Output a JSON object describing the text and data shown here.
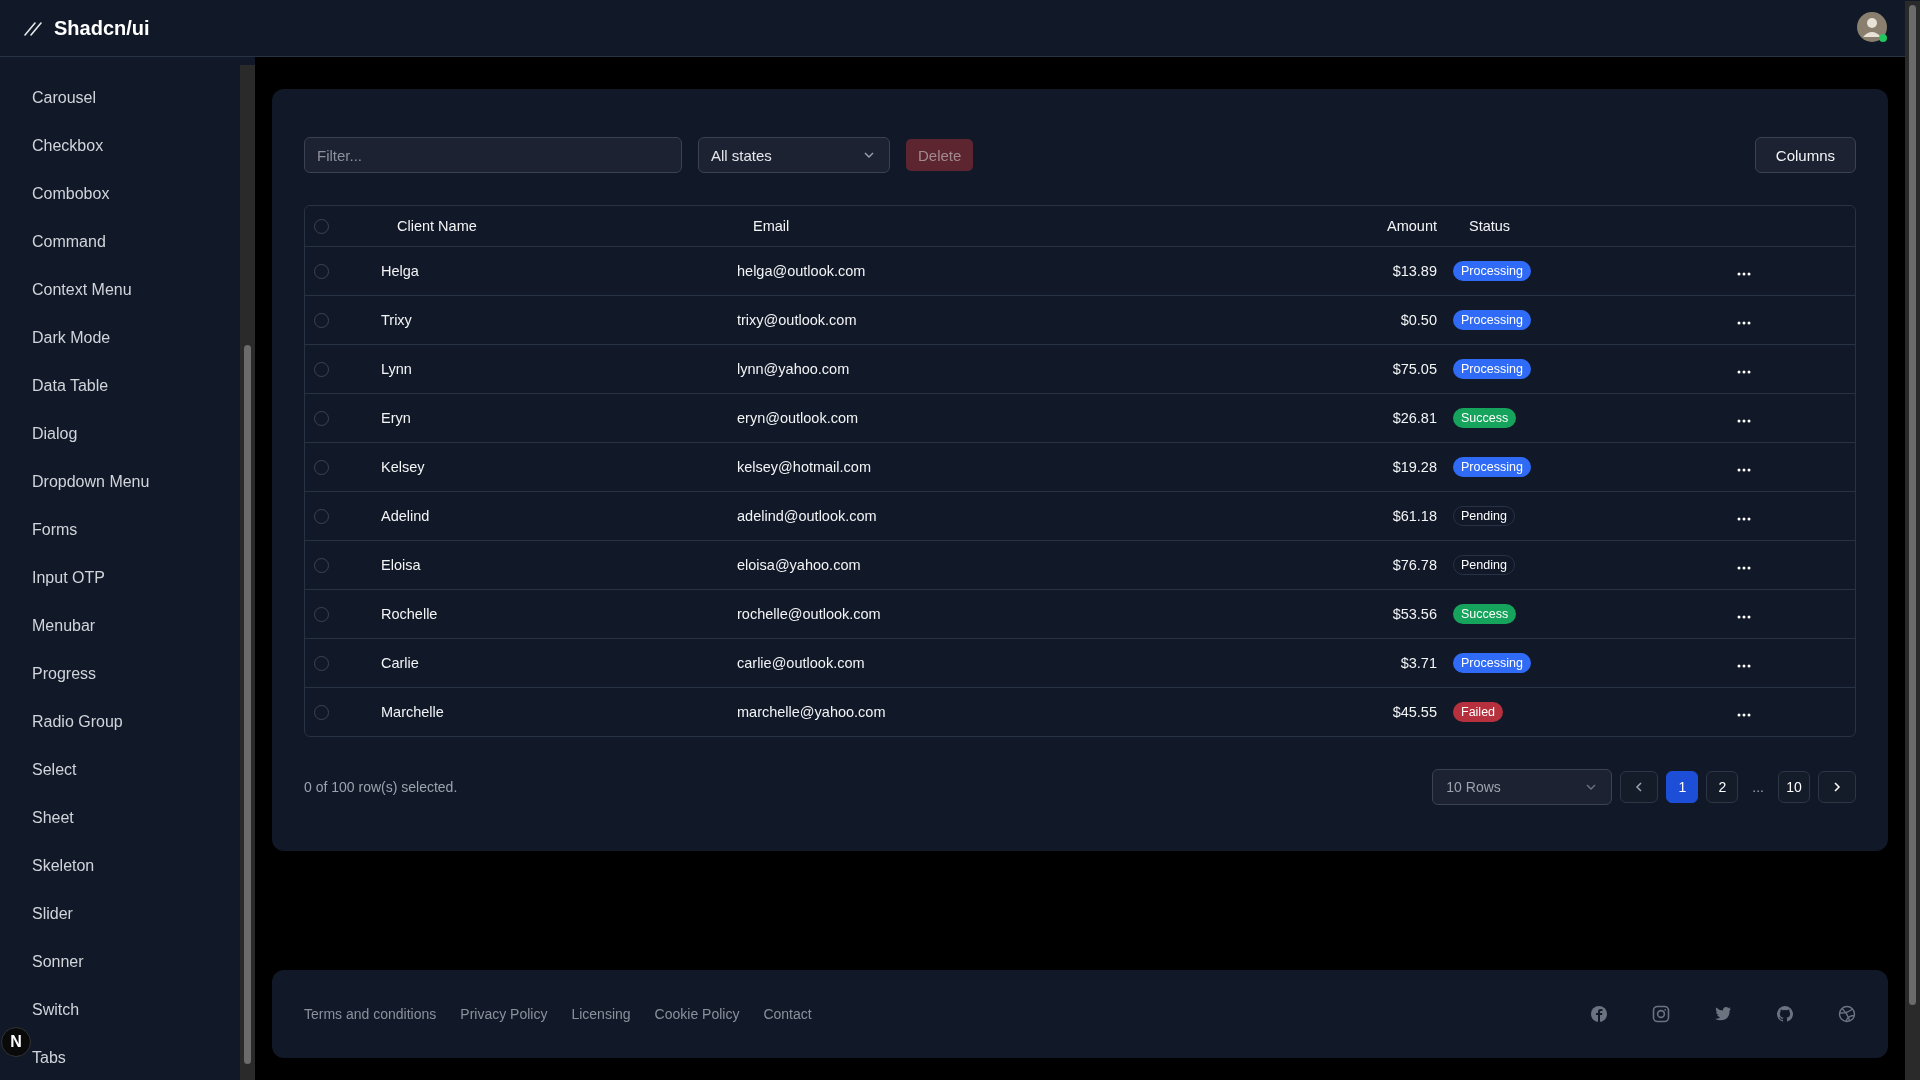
{
  "header": {
    "title": "Shadcn/ui"
  },
  "sidebar": {
    "items": [
      {
        "label": "Carousel"
      },
      {
        "label": "Checkbox"
      },
      {
        "label": "Combobox"
      },
      {
        "label": "Command"
      },
      {
        "label": "Context Menu"
      },
      {
        "label": "Dark Mode"
      },
      {
        "label": "Data Table"
      },
      {
        "label": "Dialog"
      },
      {
        "label": "Dropdown Menu"
      },
      {
        "label": "Forms"
      },
      {
        "label": "Input OTP"
      },
      {
        "label": "Menubar"
      },
      {
        "label": "Progress"
      },
      {
        "label": "Radio Group"
      },
      {
        "label": "Select"
      },
      {
        "label": "Sheet"
      },
      {
        "label": "Skeleton"
      },
      {
        "label": "Slider"
      },
      {
        "label": "Sonner"
      },
      {
        "label": "Switch"
      },
      {
        "label": "Tabs"
      }
    ]
  },
  "badge": {
    "label": "N"
  },
  "toolbar": {
    "filter": {
      "placeholder": "Filter..."
    },
    "state_select": "All states",
    "delete_button": {
      "label": "Delete",
      "disabled": true
    },
    "columns_button": "Columns"
  },
  "table": {
    "select_all": {
      "checked": false
    },
    "columns": [
      "Client Name",
      "Email",
      "Amount",
      "Status"
    ],
    "rows": [
      {
        "checked": false,
        "name": "Helga",
        "email": "helga@outlook.com",
        "amount": "$13.89",
        "status": {
          "kind": "processing",
          "label": "Processing"
        }
      },
      {
        "checked": false,
        "name": "Trixy",
        "email": "trixy@outlook.com",
        "amount": "$0.50",
        "status": {
          "kind": "processing",
          "label": "Processing"
        }
      },
      {
        "checked": false,
        "name": "Lynn",
        "email": "lynn@yahoo.com",
        "amount": "$75.05",
        "status": {
          "kind": "processing",
          "label": "Processing"
        }
      },
      {
        "checked": false,
        "name": "Eryn",
        "email": "eryn@outlook.com",
        "amount": "$26.81",
        "status": {
          "kind": "success",
          "label": "Success"
        }
      },
      {
        "checked": false,
        "name": "Kelsey",
        "email": "kelsey@hotmail.com",
        "amount": "$19.28",
        "status": {
          "kind": "processing",
          "label": "Processing"
        }
      },
      {
        "checked": false,
        "name": "Adelind",
        "email": "adelind@outlook.com",
        "amount": "$61.18",
        "status": {
          "kind": "pending",
          "label": "Pending"
        }
      },
      {
        "checked": false,
        "name": "Eloisa",
        "email": "eloisa@yahoo.com",
        "amount": "$76.78",
        "status": {
          "kind": "pending",
          "label": "Pending"
        }
      },
      {
        "checked": false,
        "name": "Rochelle",
        "email": "rochelle@outlook.com",
        "amount": "$53.56",
        "status": {
          "kind": "success",
          "label": "Success"
        }
      },
      {
        "checked": false,
        "name": "Carlie",
        "email": "carlie@outlook.com",
        "amount": "$3.71",
        "status": {
          "kind": "processing",
          "label": "Processing"
        }
      },
      {
        "checked": false,
        "name": "Marchelle",
        "email": "marchelle@yahoo.com",
        "amount": "$45.55",
        "status": {
          "kind": "failed",
          "label": "Failed"
        }
      }
    ]
  },
  "footer_bar": {
    "selection": "0 of 100 row(s) selected.",
    "rows_select": "10 Rows",
    "pages": [
      {
        "label": "1",
        "selected": true
      },
      {
        "label": "2",
        "selected": false
      },
      {
        "label": "...",
        "kind": "ellipsis"
      },
      {
        "label": "10",
        "selected": false
      }
    ]
  },
  "footer": {
    "links": [
      "Terms and conditions",
      "Privacy Policy",
      "Licensing",
      "Cookie Policy",
      "Contact"
    ]
  }
}
